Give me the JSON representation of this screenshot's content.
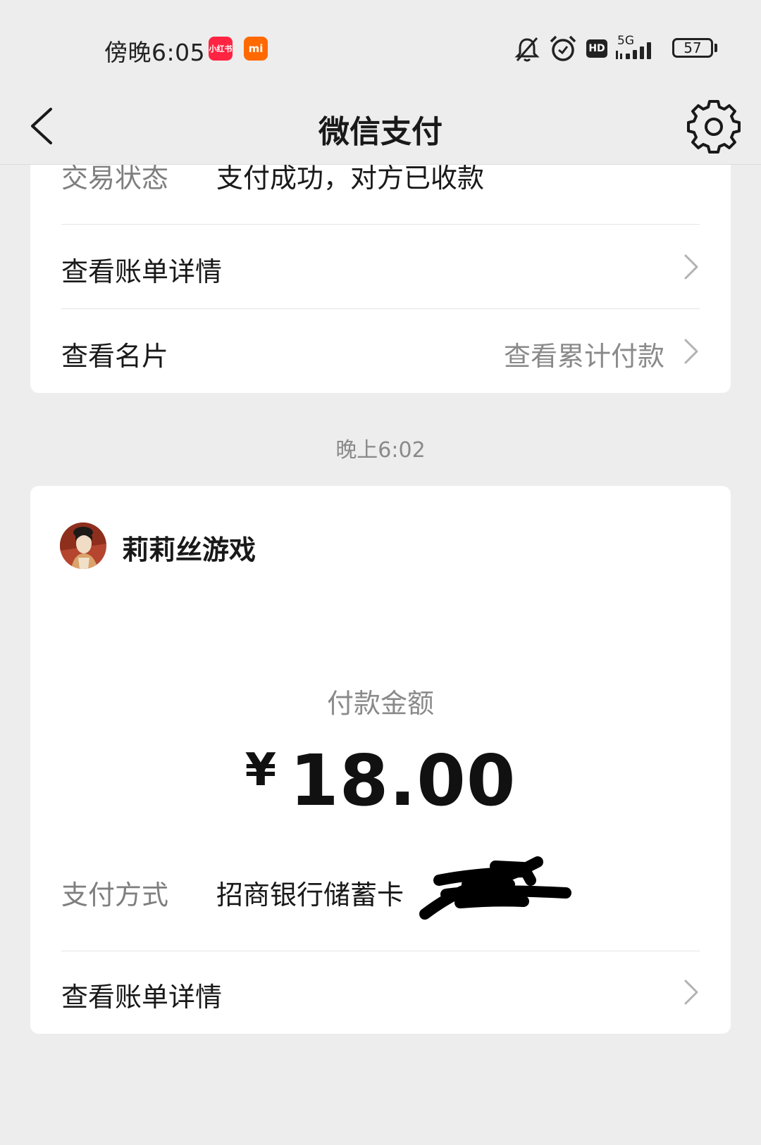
{
  "status_bar": {
    "time": "傍晚6:05",
    "app_badges": [
      "小红书",
      "mi"
    ],
    "hd": "HD",
    "network": "5G",
    "battery": "57"
  },
  "nav": {
    "title": "微信支付"
  },
  "card_prev": {
    "partial_label": "交易状态",
    "partial_value": "支付成功，对方已收款",
    "bill_details": "查看账单详情",
    "business_card": "查看名片",
    "cumulative_payment": "查看累计付款"
  },
  "time_separator": "晚上6:02",
  "card_payment": {
    "payee": "莉莉丝游戏",
    "amount_label": "付款金额",
    "currency": "¥",
    "amount": "18.00",
    "pay_method_label": "支付方式",
    "pay_method_value": "招商银行储蓄卡",
    "bill_details": "查看账单详情"
  }
}
